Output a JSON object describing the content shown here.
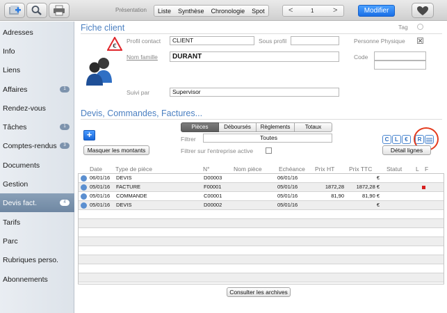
{
  "toolbar": {
    "presentation_label": "Présentation",
    "views": [
      "Liste",
      "Synthèse",
      "Chronologie",
      "Spot"
    ],
    "page_prev": "<",
    "page_number": "1",
    "page_next": ">",
    "modifier_label": "Modifier",
    "icons": [
      "add-icon",
      "search-icon",
      "print-icon",
      "heart-icon"
    ]
  },
  "sidebar": {
    "items": [
      {
        "label": "Adresses",
        "badge": ""
      },
      {
        "label": "Info",
        "badge": ""
      },
      {
        "label": "Liens",
        "badge": ""
      },
      {
        "label": "Affaires",
        "badge": "1"
      },
      {
        "label": "Rendez-vous",
        "badge": ""
      },
      {
        "label": "Tâches",
        "badge": "1"
      },
      {
        "label": "Comptes-rendus",
        "badge": "3"
      },
      {
        "label": "Documents",
        "badge": ""
      },
      {
        "label": "Gestion",
        "badge": ""
      },
      {
        "label": "Devis fact.",
        "badge": "4",
        "active": true
      },
      {
        "label": "Tarifs",
        "badge": ""
      },
      {
        "label": "Parc",
        "badge": ""
      },
      {
        "label": "Rubriques perso.",
        "badge": ""
      },
      {
        "label": "Abonnements",
        "badge": ""
      }
    ]
  },
  "fiche": {
    "title": "Fiche client",
    "tag_label": "Tag",
    "profil_contact_label": "Profil contact",
    "profil_contact_value": "CLIENT",
    "sous_profil_label": "Sous profil",
    "sous_profil_value": "",
    "personne_physique_label": "Personne Physique",
    "nom_famille_label": "Nom famille",
    "nom_famille_value": "DURANT",
    "code_label": "Code",
    "suivi_par_label": "Suivi par",
    "suivi_par_value": "Supervisor"
  },
  "devis": {
    "title": "Devis, Commandes, Factures...",
    "tabs": [
      "Pièces",
      "Déboursés",
      "Règlements",
      "Totaux"
    ],
    "active_tab": "Pièces",
    "filtrer_label": "Filtrer",
    "filtrer_value": "Toutes",
    "filtrer_entreprise_label": "Filtrer sur l'entreprise active",
    "masquer_button": "Masquer les montants",
    "detail_button": "Détail lignes",
    "mini_buttons": [
      "C",
      "L",
      "€",
      "R"
    ],
    "columns": [
      "Date",
      "Type de pièce",
      "N°",
      "Nom pièce",
      "Echéance",
      "Prix HT",
      "Prix TTC",
      "Statut",
      "L",
      "F"
    ],
    "rows": [
      {
        "date": "06/01/16",
        "type": "DEVIS",
        "num": "D00003",
        "nom": "",
        "echeance": "06/01/16",
        "ht": "",
        "ttc": "€",
        "statut": "",
        "flag": false
      },
      {
        "date": "05/01/16",
        "type": "FACTURE",
        "num": "F00001",
        "nom": "",
        "echeance": "05/01/16",
        "ht": "1872,28",
        "ttc": "1872,28 €",
        "statut": "",
        "flag": true
      },
      {
        "date": "05/01/16",
        "type": "COMMANDE",
        "num": "C00001",
        "nom": "",
        "echeance": "05/01/16",
        "ht": "81,90",
        "ttc": "81,90 €",
        "statut": "",
        "flag": false
      },
      {
        "date": "05/01/16",
        "type": "DEVIS",
        "num": "D00002",
        "nom": "",
        "echeance": "05/01/16",
        "ht": "",
        "ttc": "€",
        "statut": "",
        "flag": false
      }
    ],
    "consulter_button": "Consulter les archives"
  }
}
